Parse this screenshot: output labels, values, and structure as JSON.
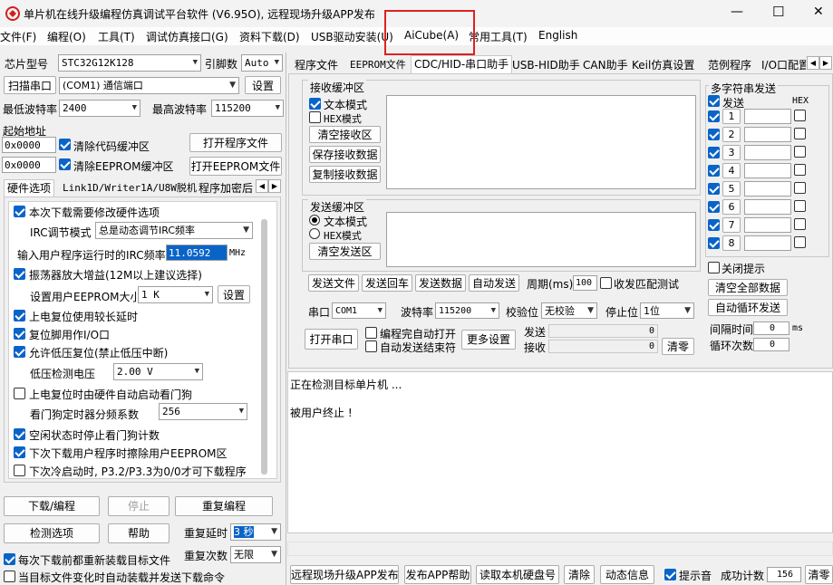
{
  "window": {
    "title": "单片机在线升级编程仿真调试平台软件 (V6.95O), 远程现场升级APP发布",
    "minimize": "—",
    "maximize": "☐",
    "close": "✕"
  },
  "menu": [
    "文件(F)",
    "编程(O)",
    "工具(T)",
    "调试仿真接口(G)",
    "资料下载(D)",
    "USB驱动安装(U)",
    "AiCube(A)",
    "常用工具(T)",
    "English"
  ],
  "left": {
    "chip_label": "芯片型号",
    "chip_value": "STC32G12K128",
    "pins_label": "引脚数",
    "pins_value": "Auto",
    "scan_btn": "扫描串口",
    "port_value": "(COM1) 通信端口",
    "settings_btn": "设置",
    "min_baud_label": "最低波特率",
    "min_baud_value": "2400",
    "max_baud_label": "最高波特率",
    "max_baud_value": "115200",
    "start_addr_label": "起始地址",
    "addr1": "0x0000",
    "clear_code": "清除代码缓冲区",
    "open_prog": "打开程序文件",
    "addr2": "0x0000",
    "clear_eeprom": "清除EEPROM缓冲区",
    "open_eeprom": "打开EEPROM文件",
    "tabs": [
      "硬件选项",
      "Link1D/Writer1A/U8W脱机",
      "程序加密后"
    ],
    "hw": {
      "opt1": "本次下载需要修改硬件选项",
      "irc_mode_label": "IRC调节模式",
      "irc_mode_value": "总是动态调节IRC频率",
      "irc_freq_label": "输入用户程序运行时的IRC频率",
      "irc_freq_value": "11.0592",
      "irc_unit": "MHz",
      "opt2": "振荡器放大增益(12M以上建议选择)",
      "eeprom_size_label": "设置用户EEPROM大小",
      "eeprom_size_value": "1   K",
      "eeprom_set_btn": "设置",
      "opt3": "上电复位使用较长延时",
      "opt4": "复位脚用作I/O口",
      "opt5": "允许低压复位(禁止低压中断)",
      "lv_label": "低压检测电压",
      "lv_value": "2.00 V",
      "opt6": "上电复位时由硬件自动启动看门狗",
      "wdt_label": "看门狗定时器分频系数",
      "wdt_value": "256",
      "opt7": "空闲状态时停止看门狗计数",
      "opt8": "下次下载用户程序时擦除用户EEPROM区",
      "opt9": "下次冷启动时, P3.2/P3.3为0/0才可下载程序"
    },
    "download_btn": "下载/编程",
    "stop_btn": "停止",
    "reprog_btn": "重复编程",
    "check_btn": "检测选项",
    "help_btn": "帮助",
    "delay_label": "重复延时",
    "delay_value": "3 秒",
    "reload_each": "每次下载前都重新装载目标文件",
    "count_label": "重复次数",
    "count_value": "无限",
    "auto_reload": "当目标文件变化时自动装载并发送下载命令"
  },
  "right": {
    "tabs": [
      "程序文件",
      "EEPROM文件",
      "CDC/HID-串口助手",
      "USB-HID助手",
      "CAN助手",
      "Keil仿真设置",
      "范例程序",
      "I/O口配置"
    ],
    "recv_title": "接收缓冲区",
    "recv_text_mode": "文本模式",
    "recv_hex_mode": "HEX模式",
    "clear_recv": "清空接收区",
    "save_recv": "保存接收数据",
    "copy_recv": "复制接收数据",
    "send_title": "发送缓冲区",
    "send_text_mode": "文本模式",
    "send_hex_mode": "HEX模式",
    "clear_send": "清空发送区",
    "send_file": "发送文件",
    "send_cr": "发送回车",
    "send_data": "发送数据",
    "auto_send": "自动发送",
    "period_label": "周期(ms)",
    "period_value": "100",
    "recv_match": "收发匹配测试",
    "port_label": "串口",
    "port_value": "COM1",
    "baud_label": "波特率",
    "baud_value": "115200",
    "parity_label": "校验位",
    "parity_value": "无校验",
    "stop_label": "停止位",
    "stop_value": "1位",
    "open_port": "打开串口",
    "auto_open": "编程完自动打开",
    "auto_send_end": "自动发送结束符",
    "more_settings": "更多设置",
    "send_count_label": "发送",
    "send_count": "0",
    "recv_count_label": "接收",
    "recv_count": "0",
    "clear_counts": "清零",
    "multi_title": "多字符串发送",
    "send_col": "发送",
    "hex_col": "HEX",
    "rows": [
      "1",
      "2",
      "3",
      "4",
      "5",
      "6",
      "7",
      "8"
    ],
    "close_hint": "关闭提示",
    "clear_all": "清空全部数据",
    "auto_loop": "自动循环发送",
    "interval_label": "间隔时间",
    "interval_value": "0",
    "interval_unit": "ms",
    "loop_label": "循环次数",
    "loop_value": "0"
  },
  "log": {
    "line1": "正在检测目标单片机 ...",
    "line2": "被用户终止 !"
  },
  "bottom": {
    "remote_app": "远程现场升级APP发布",
    "publish_help": "发布APP帮助",
    "read_disk": "读取本机硬盘号",
    "clear": "清除",
    "anim": "动态信息",
    "beep": "提示音",
    "success_label": "成功计数",
    "success_count": "156",
    "zero": "清零"
  },
  "colors": {
    "accent": "#0a64c8",
    "highlight_box": "#e02020"
  }
}
